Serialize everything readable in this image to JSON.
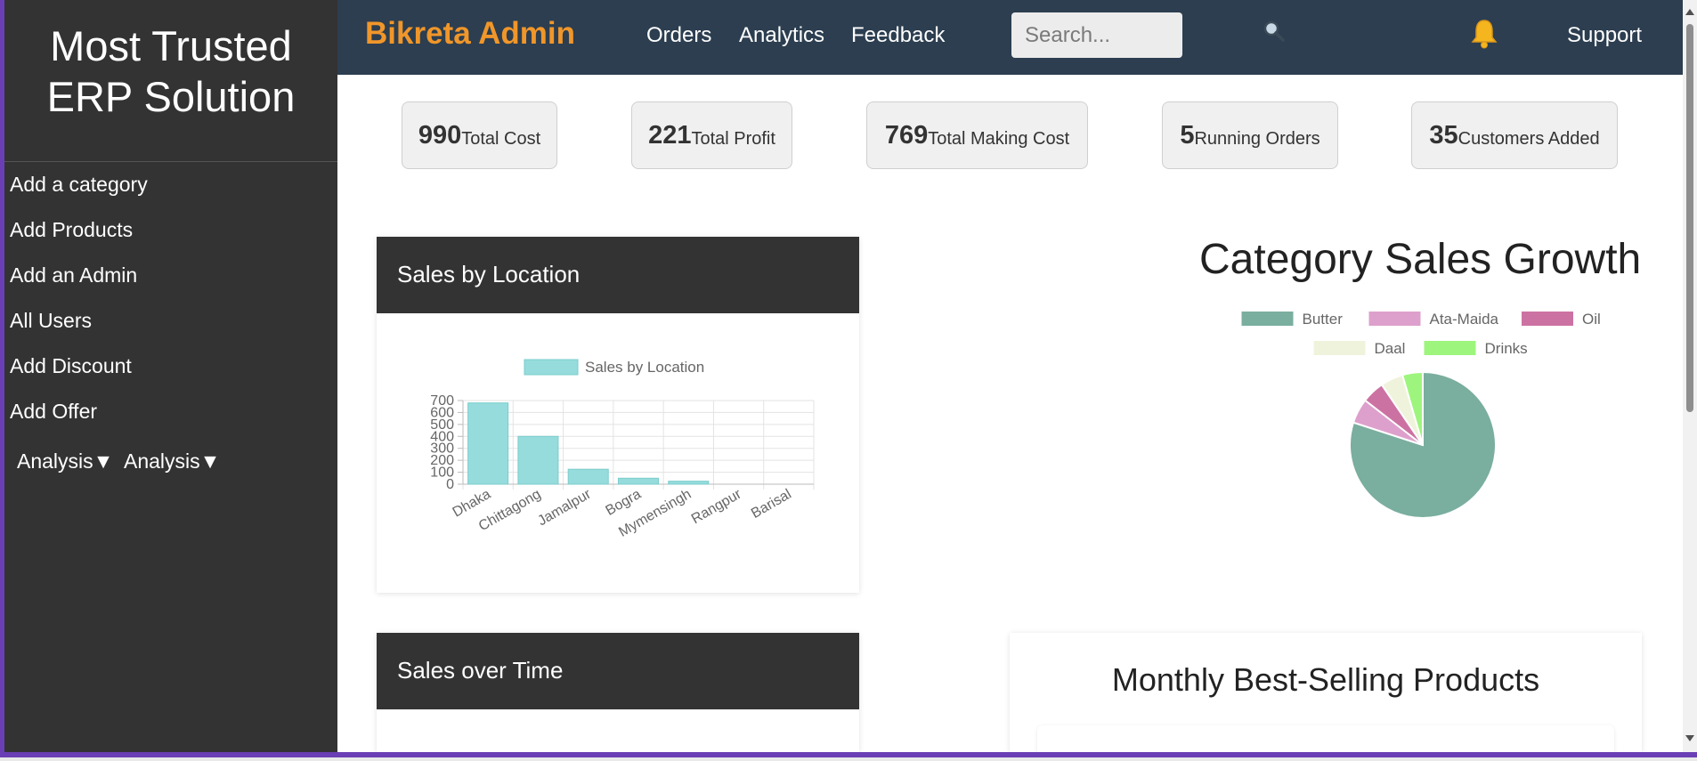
{
  "sidebar": {
    "title": "Most Trusted ERP Solution",
    "title_line1": "Most Trusted",
    "title_line2": "ERP Solution",
    "items": [
      {
        "label": "Add a category"
      },
      {
        "label": "Add Products"
      },
      {
        "label": "Add an Admin"
      },
      {
        "label": "All Users"
      },
      {
        "label": "Add Discount"
      },
      {
        "label": "Add Offer"
      }
    ],
    "dropdowns": [
      {
        "label": "Analysis▼"
      },
      {
        "label": "Analysis▼"
      }
    ]
  },
  "topnav": {
    "brand": "Bikreta Admin",
    "links": [
      "Orders",
      "Analytics",
      "Feedback"
    ],
    "search_placeholder": "Search...",
    "search_icon": "search-icon",
    "bell_icon": "bell-icon",
    "support": "Support"
  },
  "stats": [
    {
      "value": "990",
      "label": "Total Cost"
    },
    {
      "value": "221",
      "label": "Total Profit"
    },
    {
      "value": "769",
      "label": "Total Making Cost"
    },
    {
      "value": "5",
      "label": "Running Orders"
    },
    {
      "value": "35",
      "label": "Customers Added"
    }
  ],
  "cards": {
    "sales_by_location": "Sales by Location",
    "sales_over_time": "Sales over Time",
    "category_sales_growth": "Category Sales Growth",
    "monthly_best_selling": "Monthly Best-Selling Products"
  },
  "colors": {
    "nav_bg": "#2c3e50",
    "brand_orange": "#f0962a",
    "sidebar_bg": "#333333",
    "bar_fill": "#96dcdc",
    "bar_stroke": "#7ccccc"
  },
  "chart_data": [
    {
      "type": "bar",
      "title": "",
      "legend": [
        "Sales by Location"
      ],
      "categories": [
        "Dhaka",
        "Chittagong",
        "Jamalpur",
        "Bogra",
        "Mymensingh",
        "Rangpur",
        "Barisal"
      ],
      "series": [
        {
          "name": "Sales by Location",
          "values": [
            680,
            400,
            125,
            50,
            25,
            0,
            0
          ]
        }
      ],
      "ylim": [
        0,
        700
      ],
      "yticks": [
        0,
        100,
        200,
        300,
        400,
        500,
        600,
        700
      ],
      "grid": true,
      "legend_position": "top"
    },
    {
      "type": "pie",
      "title": "Category Sales Growth",
      "legend_position": "top",
      "labels": [
        "Butter",
        "Ata-Maida",
        "Oil",
        "Daal",
        "Drinks"
      ],
      "values": [
        80,
        5.5,
        5,
        5,
        4.5
      ],
      "colors": [
        "#7aae9f",
        "#dda0cc",
        "#cc72a3",
        "#f0f3dc",
        "#9ef57d"
      ]
    }
  ]
}
